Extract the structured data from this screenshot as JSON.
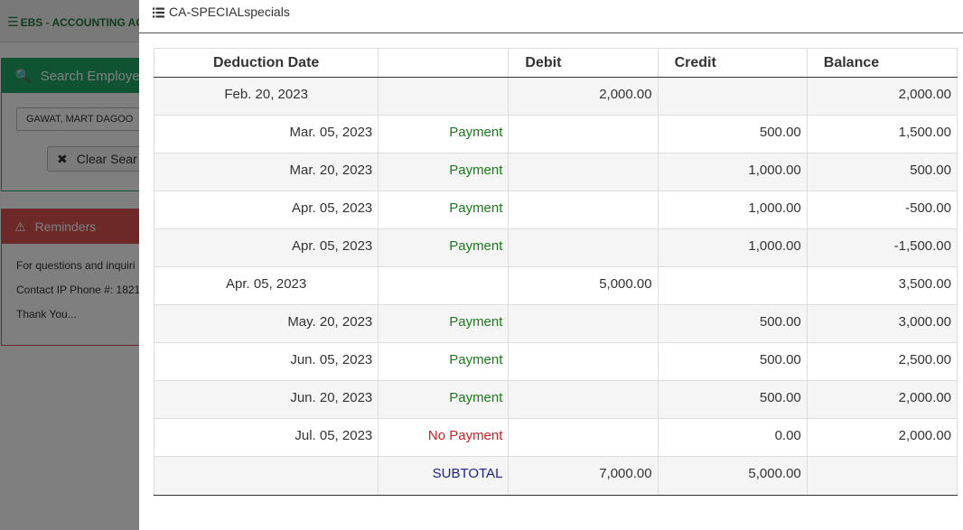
{
  "background": {
    "brand": "EBS - ACCOUNTING ACC",
    "search_title": "Search Employee",
    "employee_value": "GAWAT, MART DAGOO",
    "clear_label": "Clear Sear",
    "reminders_title": "Reminders",
    "reminder_lines": [
      "For questions and inquiri",
      "Contact IP Phone #: 1821",
      "Thank You..."
    ]
  },
  "modal": {
    "title": "CA-SPECIALspecials"
  },
  "table": {
    "headers": {
      "date": "Deduction Date",
      "status": "",
      "debit": "Debit",
      "credit": "Credit",
      "balance": "Balance"
    },
    "rows": [
      {
        "date": "Feb. 20, 2023",
        "status": "",
        "debit": "2,000.00",
        "credit": "",
        "balance": "2,000.00"
      },
      {
        "date": "Mar. 05, 2023",
        "status": "Payment",
        "debit": "",
        "credit": "500.00",
        "balance": "1,500.00"
      },
      {
        "date": "Mar. 20, 2023",
        "status": "Payment",
        "debit": "",
        "credit": "1,000.00",
        "balance": "500.00"
      },
      {
        "date": "Apr. 05, 2023",
        "status": "Payment",
        "debit": "",
        "credit": "1,000.00",
        "balance": "-500.00"
      },
      {
        "date": "Apr. 05, 2023",
        "status": "Payment",
        "debit": "",
        "credit": "1,000.00",
        "balance": "-1,500.00"
      },
      {
        "date": "Apr. 05, 2023",
        "status": "",
        "debit": "5,000.00",
        "credit": "",
        "balance": "3,500.00"
      },
      {
        "date": "May. 20, 2023",
        "status": "Payment",
        "debit": "",
        "credit": "500.00",
        "balance": "3,000.00"
      },
      {
        "date": "Jun. 05, 2023",
        "status": "Payment",
        "debit": "",
        "credit": "500.00",
        "balance": "2,500.00"
      },
      {
        "date": "Jun. 20, 2023",
        "status": "Payment",
        "debit": "",
        "credit": "500.00",
        "balance": "2,000.00"
      },
      {
        "date": "Jul. 05, 2023",
        "status": "No Payment",
        "debit": "",
        "credit": "0.00",
        "balance": "2,000.00"
      }
    ],
    "subtotal": {
      "label": "SUBTOTAL",
      "debit": "7,000.00",
      "credit": "5,000.00"
    }
  }
}
